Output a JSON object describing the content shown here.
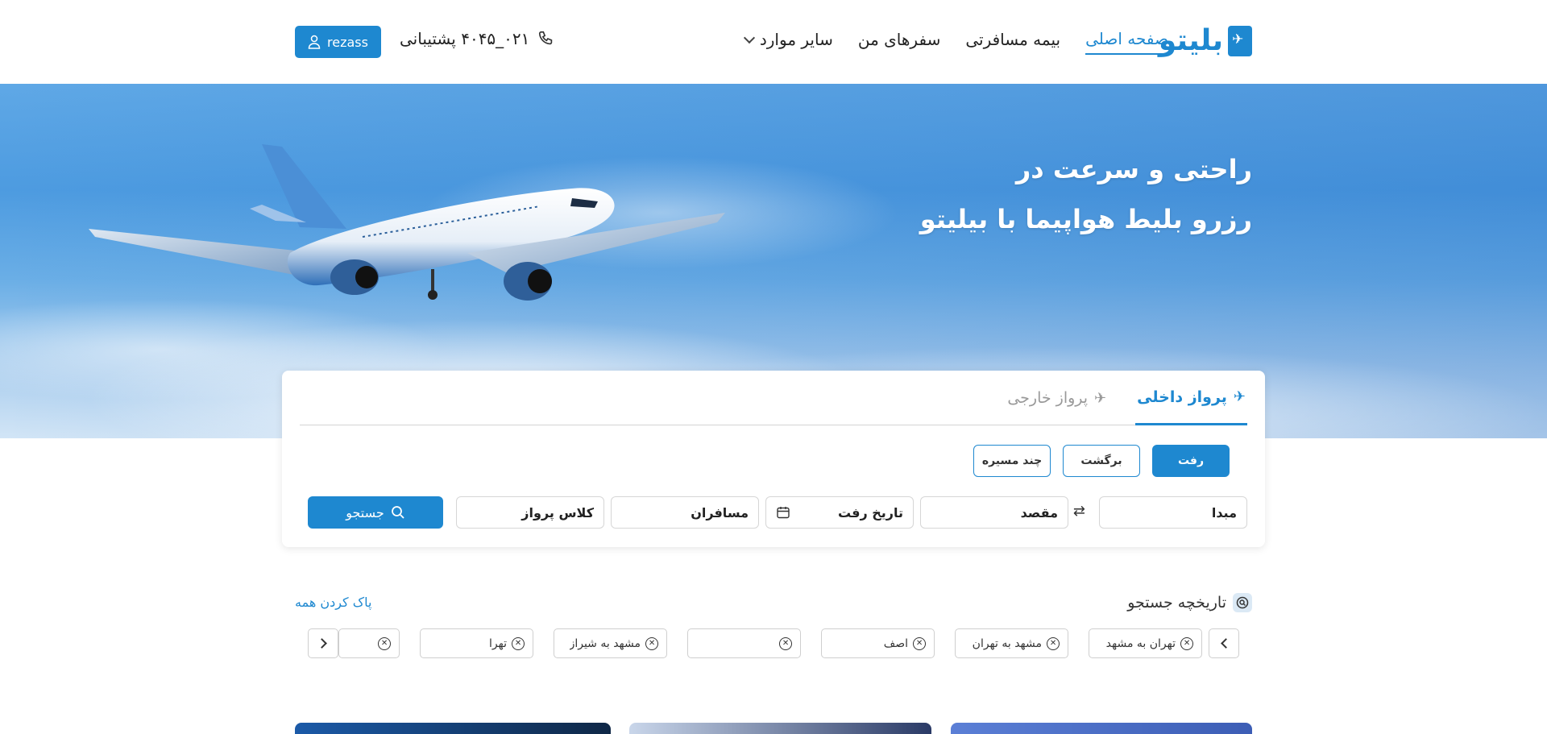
{
  "header": {
    "logo_text": "بلیتو",
    "nav": [
      {
        "label": "صفحه اصلی"
      },
      {
        "label": "بیمه مسافرتی"
      },
      {
        "label": "سفرهای من"
      },
      {
        "label": "سایر موارد"
      }
    ],
    "support_text": "۰۲۱_۴۰۴۵ پشتیبانی",
    "user_label": "rezass"
  },
  "hero": {
    "line1": "راحتی و سرعت در",
    "line2": "رزرو بلیط هواپیما با بیلیتو"
  },
  "search": {
    "tabs": [
      {
        "label": "پرواز داخلی"
      },
      {
        "label": "پرواز خارجی"
      }
    ],
    "trip_types": [
      {
        "label": "رفت"
      },
      {
        "label": "برگشت"
      },
      {
        "label": "چند مسیره"
      }
    ],
    "fields": {
      "origin": "مبدا",
      "destination": "مقصد",
      "date": "تاریخ رفت",
      "passengers": "مسافران",
      "class": "کلاس پرواز"
    },
    "search_label": "جستجو"
  },
  "history": {
    "title": "تاریخچه جستجو",
    "clear_label": "پاک کردن همه",
    "chips": [
      {
        "text": "تهران به مشهد"
      },
      {
        "text": "مشهد به تهران"
      },
      {
        "text": "اصف"
      },
      {
        "text": ""
      },
      {
        "text": "مشهد به شیراز"
      },
      {
        "text": "تهرا"
      },
      {
        "text": ""
      }
    ]
  },
  "colors": {
    "accent": "#1e88d0"
  }
}
